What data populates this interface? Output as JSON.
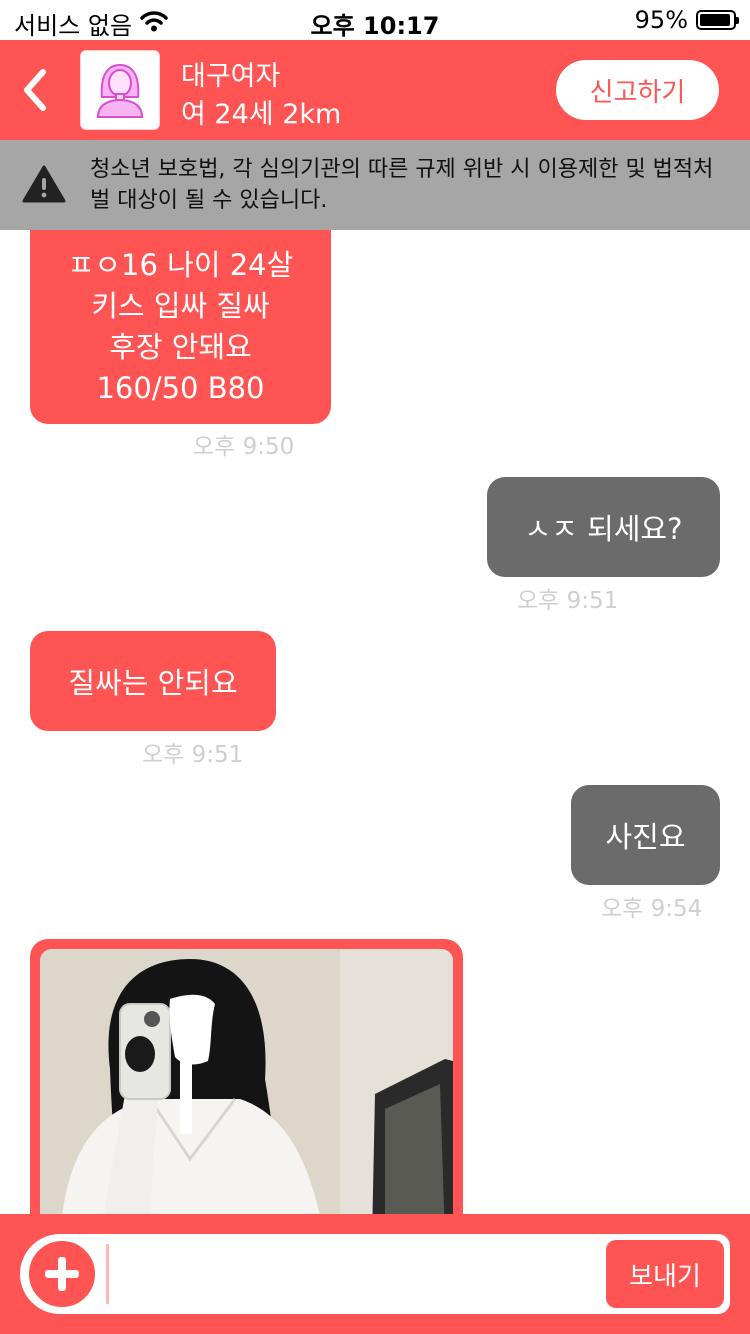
{
  "status_bar": {
    "carrier": "서비스 없음",
    "time": "오후 10:17",
    "battery": "95%",
    "battery_level": 0.95
  },
  "header": {
    "name": "대구여자",
    "info": "여 24세 2km",
    "report_label": "신고하기"
  },
  "warning": {
    "text": "청소년 보호법, 각 심의기관의 따른 규제 위반 시 이용제한 및 법적처벌 대상이 될 수 있습니다."
  },
  "messages": [
    {
      "direction": "in",
      "lines": [
        "ㅍㅇ16 나이 24살",
        "키스 입싸 질싸",
        "후장 안돼요",
        "160/50 B80"
      ],
      "time": "오후 9:50"
    },
    {
      "direction": "out",
      "text": "ㅅㅈ 되세요?",
      "time": "오후 9:51"
    },
    {
      "direction": "in",
      "text": "질싸는 안되요",
      "time": "오후 9:51"
    },
    {
      "direction": "out",
      "text": "사진요",
      "time": "오후 9:54"
    },
    {
      "direction": "in",
      "type": "image"
    }
  ],
  "input": {
    "value": "",
    "send_label": "보내기"
  },
  "colors": {
    "accent": "#ff5454",
    "outgoing_bubble": "#6b6b6b",
    "warning_bg": "#a6a6a6"
  }
}
